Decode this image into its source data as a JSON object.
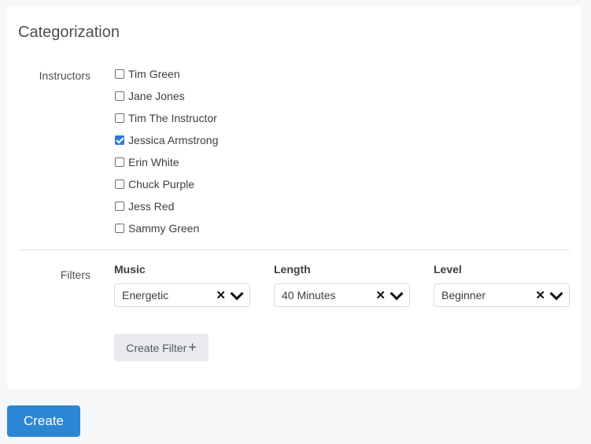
{
  "section": {
    "title": "Categorization"
  },
  "instructors": {
    "label": "Instructors",
    "items": [
      {
        "name": "Tim Green",
        "checked": false
      },
      {
        "name": "Jane Jones",
        "checked": false
      },
      {
        "name": "Tim The Instructor",
        "checked": false
      },
      {
        "name": "Jessica Armstrong",
        "checked": true
      },
      {
        "name": "Erin White",
        "checked": false
      },
      {
        "name": "Chuck Purple",
        "checked": false
      },
      {
        "name": "Jess Red",
        "checked": false
      },
      {
        "name": "Sammy Green",
        "checked": false
      }
    ]
  },
  "filters": {
    "label": "Filters",
    "items": [
      {
        "label": "Music",
        "value": "Energetic",
        "clear_icon": "x-icon",
        "dropdown_icon": "chevron-down-icon"
      },
      {
        "label": "Length",
        "value": "40 Minutes",
        "clear_icon": "x-icon",
        "dropdown_icon": "chevron-down-icon"
      },
      {
        "label": "Level",
        "value": "Beginner",
        "clear_icon": "x-icon",
        "dropdown_icon": "chevron-down-icon"
      }
    ],
    "create_filter_label": "Create Filter",
    "create_filter_icon": "plus-icon"
  },
  "actions": {
    "create_label": "Create"
  },
  "colors": {
    "primary": "#2b87d3",
    "checkbox_checked": "#2f7bd9",
    "page_bg": "#f6f7f9",
    "secondary_button_bg": "#e9ebee"
  }
}
